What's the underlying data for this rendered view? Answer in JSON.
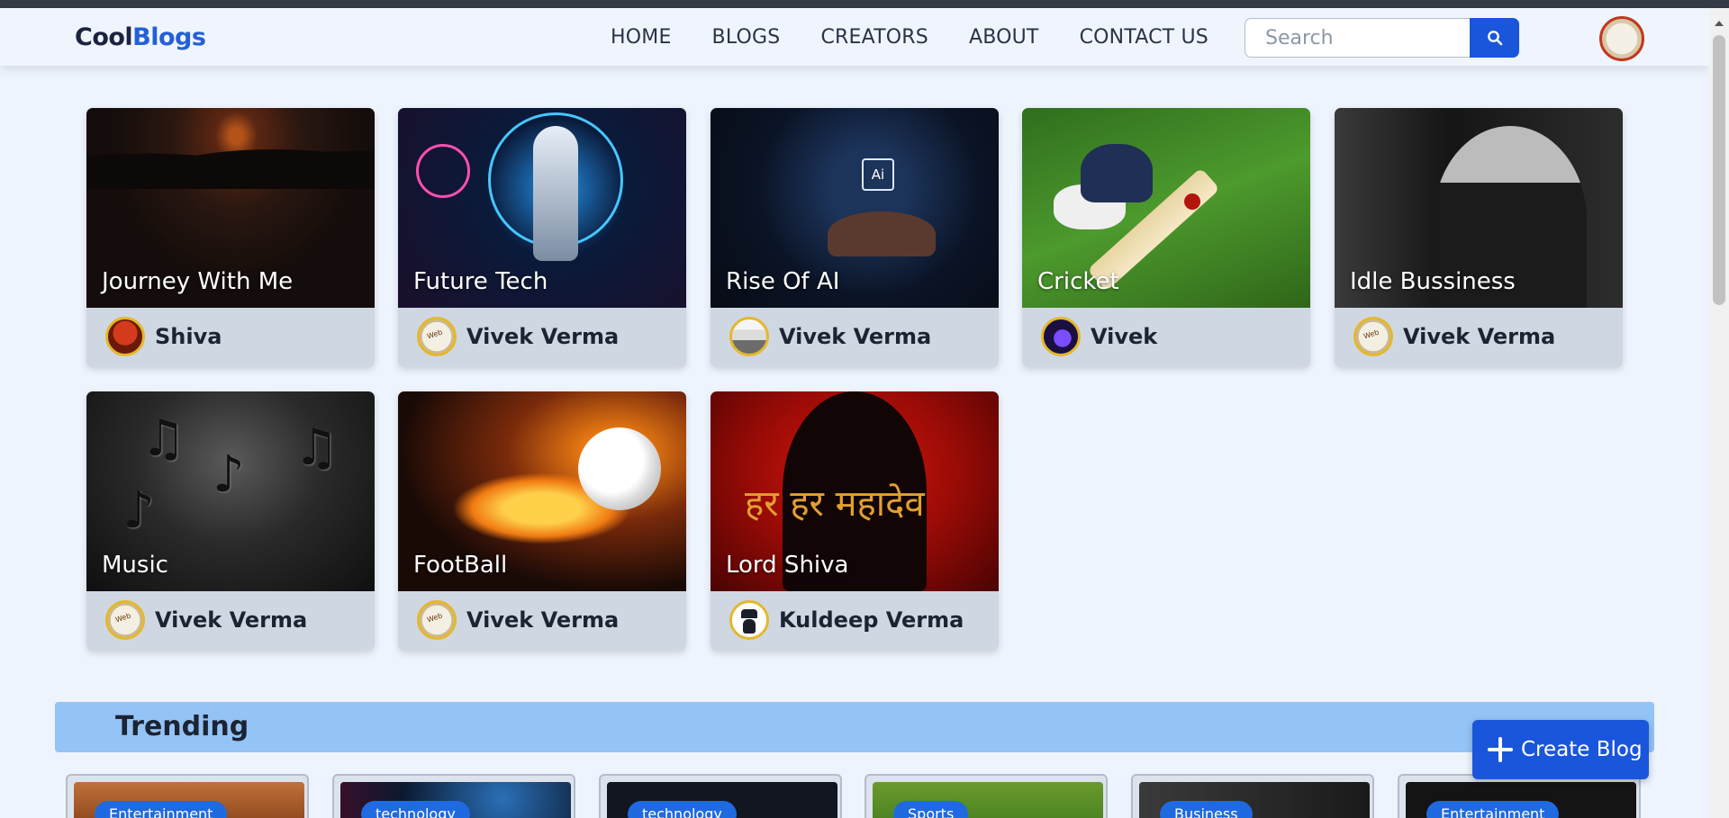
{
  "nav": {
    "logo_part1": "Cool",
    "logo_part2": "Blogs",
    "links": [
      "HOME",
      "BLOGS",
      "CREATORS",
      "ABOUT",
      "CONTACT US"
    ],
    "search_placeholder": "Search"
  },
  "blogs": [
    {
      "title": "Journey With Me",
      "author": "Shiva"
    },
    {
      "title": "Future Tech",
      "author": "Vivek Verma"
    },
    {
      "title": "Rise Of AI",
      "author": "Vivek Verma"
    },
    {
      "title": "Cricket",
      "author": "Vivek"
    },
    {
      "title": "Idle Bussiness",
      "author": "Vivek Verma"
    },
    {
      "title": "Music",
      "author": "Vivek Verma"
    },
    {
      "title": "FootBall",
      "author": "Vivek Verma"
    },
    {
      "title": "Lord Shiva",
      "author": "Kuldeep Verma"
    }
  ],
  "image_text": {
    "ai_chip": "Ai",
    "shiva": "हर हर महादेव"
  },
  "trending": {
    "title": "Trending",
    "tags": [
      "Entertainment",
      "technology",
      "technology",
      "Sports",
      "Business",
      "Entertainment"
    ]
  },
  "create_blog_label": "Create Blog",
  "colors": {
    "accent": "#1a56db",
    "trending_bar": "#94c3f6",
    "background": "#eef4fd"
  }
}
